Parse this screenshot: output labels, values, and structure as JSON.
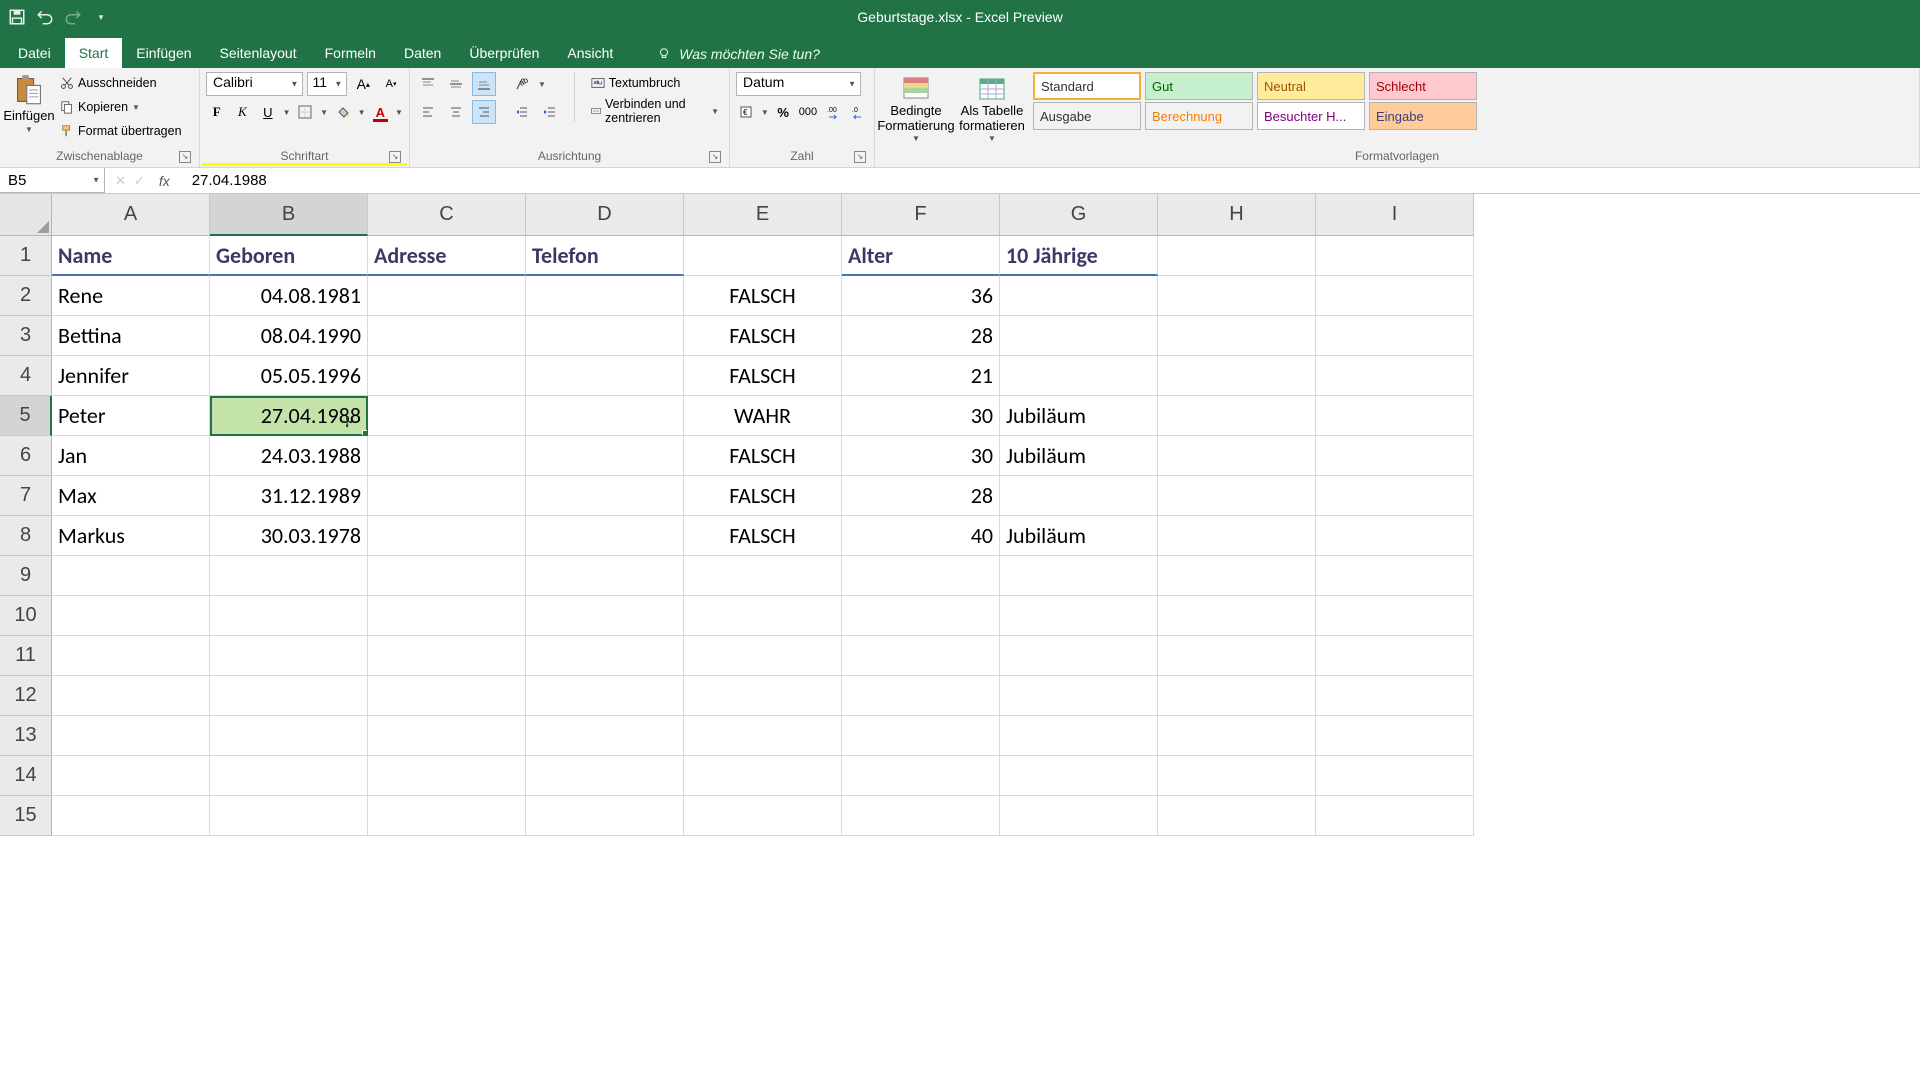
{
  "title": "Geburtstage.xlsx  -  Excel Preview",
  "tabs": [
    "Datei",
    "Start",
    "Einfügen",
    "Seitenlayout",
    "Formeln",
    "Daten",
    "Überprüfen",
    "Ansicht"
  ],
  "active_tab": "Start",
  "tellme": "Was möchten Sie tun?",
  "clipboard": {
    "paste": "Einfügen",
    "cut": "Ausschneiden",
    "copy": "Kopieren",
    "fmtpaint": "Format übertragen",
    "label": "Zwischenablage"
  },
  "font": {
    "name": "Calibri",
    "size": "11",
    "label": "Schriftart"
  },
  "alignment": {
    "wrap": "Textumbruch",
    "merge": "Verbinden und zentrieren",
    "label": "Ausrichtung"
  },
  "number": {
    "format": "Datum",
    "label": "Zahl"
  },
  "styles": {
    "cond": "Bedingte Formatierung",
    "table": "Als Tabelle formatieren",
    "chips": [
      {
        "t": "Standard",
        "bg": "#ffffff",
        "fg": "#333333"
      },
      {
        "t": "Gut",
        "bg": "#c6efce",
        "fg": "#006100"
      },
      {
        "t": "Neutral",
        "bg": "#ffeb9c",
        "fg": "#9c5700"
      },
      {
        "t": "Schlecht",
        "bg": "#ffc7ce",
        "fg": "#9c0006"
      },
      {
        "t": "Ausgabe",
        "bg": "#f2f2f2",
        "fg": "#333333"
      },
      {
        "t": "Berechnung",
        "bg": "#f2f2f2",
        "fg": "#fa7d00"
      },
      {
        "t": "Besuchter H...",
        "bg": "#ffffff",
        "fg": "#800080"
      },
      {
        "t": "Eingabe",
        "bg": "#ffcc99",
        "fg": "#3f3f76"
      }
    ],
    "label": "Formatvorlagen"
  },
  "namebox": "B5",
  "formula": "27.04.1988",
  "columns": [
    "A",
    "B",
    "C",
    "D",
    "E",
    "F",
    "G",
    "H",
    "I"
  ],
  "active_col": "B",
  "active_row": 5,
  "headers": {
    "A": "Name",
    "B": "Geboren",
    "C": "Adresse",
    "D": "Telefon",
    "E": "",
    "F": "Alter",
    "G": "10 Jährige",
    "H": "",
    "I": ""
  },
  "rows": [
    {
      "n": 2,
      "A": "Rene",
      "B": "04.08.1981",
      "E": "FALSCH",
      "F": "36",
      "G": ""
    },
    {
      "n": 3,
      "A": "Bettina",
      "B": "08.04.1990",
      "E": "FALSCH",
      "F": "28",
      "G": ""
    },
    {
      "n": 4,
      "A": "Jennifer",
      "B": "05.05.1996",
      "E": "FALSCH",
      "F": "21",
      "G": ""
    },
    {
      "n": 5,
      "A": "Peter",
      "B": "27.04.1988",
      "E": "WAHR",
      "F": "30",
      "G": "Jubiläum"
    },
    {
      "n": 6,
      "A": "Jan",
      "B": "24.03.1988",
      "E": "FALSCH",
      "F": "30",
      "G": "Jubiläum"
    },
    {
      "n": 7,
      "A": "Max",
      "B": "31.12.1989",
      "E": "FALSCH",
      "F": "28",
      "G": ""
    },
    {
      "n": 8,
      "A": "Markus",
      "B": "30.03.1978",
      "E": "FALSCH",
      "F": "40",
      "G": "Jubiläum"
    }
  ],
  "empty_rows": [
    9,
    10,
    11,
    12,
    13,
    14,
    15
  ]
}
